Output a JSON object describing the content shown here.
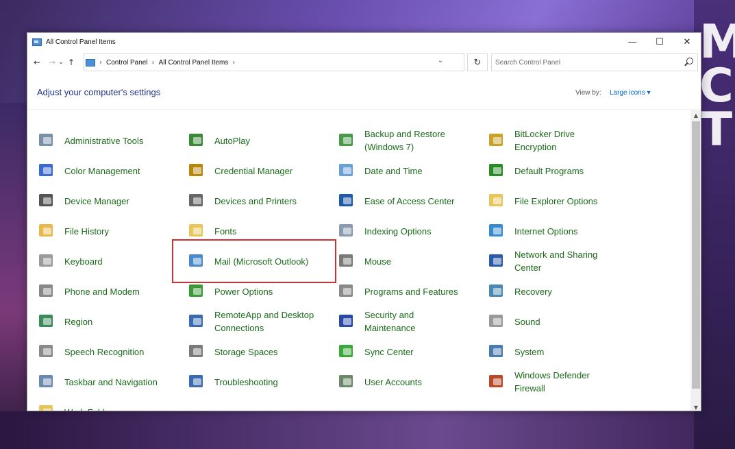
{
  "window": {
    "title": "All Control Panel Items",
    "controls": {
      "minimize": "—",
      "maximize": "☐",
      "close": "✕"
    }
  },
  "nav": {
    "back": "←",
    "forward": "→",
    "recent": "⌄",
    "up": "↑",
    "breadcrumbs": [
      "Control Panel",
      "All Control Panel Items"
    ],
    "separator": "›",
    "dropdown": "⌄",
    "refresh": "↻",
    "search_placeholder": "Search Control Panel"
  },
  "header": {
    "title": "Adjust your computer's settings",
    "view_by_label": "View by:",
    "view_by_value": "Large icons ▾"
  },
  "items": [
    {
      "label": "Administrative Tools",
      "icon": "administrative-tools-icon",
      "color": "#7a8fa8"
    },
    {
      "label": "AutoPlay",
      "icon": "autoplay-icon",
      "color": "#3a8a3a"
    },
    {
      "label": "Backup and Restore (Windows 7)",
      "icon": "backup-restore-icon",
      "color": "#4a9a4a"
    },
    {
      "label": "BitLocker Drive Encryption",
      "icon": "bitlocker-icon",
      "color": "#c9a227"
    },
    {
      "label": "Color Management",
      "icon": "color-management-icon",
      "color": "#3a6ad0"
    },
    {
      "label": "Credential Manager",
      "icon": "credential-manager-icon",
      "color": "#b8860b"
    },
    {
      "label": "Date and Time",
      "icon": "date-time-icon",
      "color": "#6aa0d8"
    },
    {
      "label": "Default Programs",
      "icon": "default-programs-icon",
      "color": "#2a8a2a"
    },
    {
      "label": "Device Manager",
      "icon": "device-manager-icon",
      "color": "#555555"
    },
    {
      "label": "Devices and Printers",
      "icon": "devices-printers-icon",
      "color": "#666666"
    },
    {
      "label": "Ease of Access Center",
      "icon": "ease-of-access-icon",
      "color": "#1e5aa8"
    },
    {
      "label": "File Explorer Options",
      "icon": "file-explorer-options-icon",
      "color": "#e8c65a"
    },
    {
      "label": "File History",
      "icon": "file-history-icon",
      "color": "#e8b84a"
    },
    {
      "label": "Fonts",
      "icon": "fonts-icon",
      "color": "#e8c65a"
    },
    {
      "label": "Indexing Options",
      "icon": "indexing-options-icon",
      "color": "#8a9ab0"
    },
    {
      "label": "Internet Options",
      "icon": "internet-options-icon",
      "color": "#3a8ad0"
    },
    {
      "label": "Keyboard",
      "icon": "keyboard-icon",
      "color": "#9a9a9a"
    },
    {
      "label": "Mail (Microsoft Outlook)",
      "icon": "mail-outlook-icon",
      "color": "#4a8ac8"
    },
    {
      "label": "Mouse",
      "icon": "mouse-icon",
      "color": "#7a7a7a"
    },
    {
      "label": "Network and Sharing Center",
      "icon": "network-sharing-icon",
      "color": "#2a5aa8"
    },
    {
      "label": "Phone and Modem",
      "icon": "phone-modem-icon",
      "color": "#888888"
    },
    {
      "label": "Power Options",
      "icon": "power-options-icon",
      "color": "#3a9a3a"
    },
    {
      "label": "Programs and Features",
      "icon": "programs-features-icon",
      "color": "#8a8a8a"
    },
    {
      "label": "Recovery",
      "icon": "recovery-icon",
      "color": "#4a8ab0"
    },
    {
      "label": "Region",
      "icon": "region-icon",
      "color": "#3a8a5a"
    },
    {
      "label": "RemoteApp and Desktop Connections",
      "icon": "remoteapp-icon",
      "color": "#3a6ab0"
    },
    {
      "label": "Security and Maintenance",
      "icon": "security-maintenance-icon",
      "color": "#2a4aa8"
    },
    {
      "label": "Sound",
      "icon": "sound-icon",
      "color": "#9a9a9a"
    },
    {
      "label": "Speech Recognition",
      "icon": "speech-recognition-icon",
      "color": "#8a8a8a"
    },
    {
      "label": "Storage Spaces",
      "icon": "storage-spaces-icon",
      "color": "#7a7a7a"
    },
    {
      "label": "Sync Center",
      "icon": "sync-center-icon",
      "color": "#3aa83a"
    },
    {
      "label": "System",
      "icon": "system-icon",
      "color": "#4a7ab0"
    },
    {
      "label": "Taskbar and Navigation",
      "icon": "taskbar-navigation-icon",
      "color": "#6a8ab0"
    },
    {
      "label": "Troubleshooting",
      "icon": "troubleshooting-icon",
      "color": "#3a6ab0"
    },
    {
      "label": "User Accounts",
      "icon": "user-accounts-icon",
      "color": "#6a8a6a"
    },
    {
      "label": "Windows Defender Firewall",
      "icon": "firewall-icon",
      "color": "#b84a2a"
    },
    {
      "label": "Work Folders",
      "icon": "work-folders-icon",
      "color": "#e8c65a"
    }
  ],
  "highlight_color": "#d32f2f",
  "link_color": "#1a6b1a",
  "background_text": [
    "M",
    "C",
    "T"
  ]
}
